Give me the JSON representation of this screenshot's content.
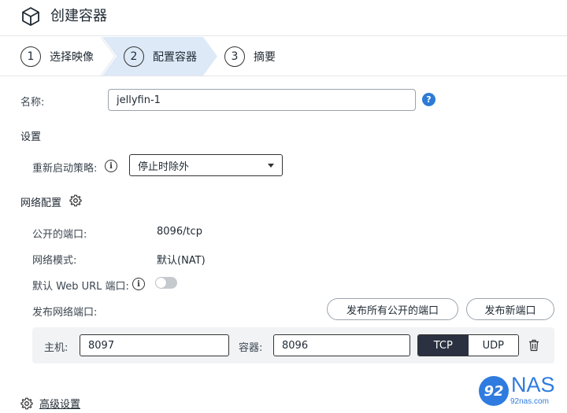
{
  "header": {
    "title": "创建容器",
    "icon": "cube-icon"
  },
  "steps": [
    {
      "num": "1",
      "label": "选择映像"
    },
    {
      "num": "2",
      "label": "配置容器"
    },
    {
      "num": "3",
      "label": "摘要"
    }
  ],
  "active_step_color": "#dde9f7",
  "name": {
    "label": "名称:",
    "value": "jellyfin-1"
  },
  "settings": {
    "section_title": "设置",
    "restart_label": "重新启动策略:",
    "restart_value": "停止时除外"
  },
  "network": {
    "section_title": "网络配置",
    "public_ports_label": "公开的端口:",
    "public_ports_value": "8096/tcp",
    "mode_label": "网络模式:",
    "mode_value": "默认(NAT)",
    "web_url_label": "默认 Web URL 端口:",
    "publish_label": "发布网络端口:",
    "publish_all_button": "发布所有公开的端口",
    "publish_new_button": "发布新端口"
  },
  "port_mapping": {
    "host_label": "主机:",
    "host_value": "8097",
    "container_label": "容器:",
    "container_value": "8096",
    "protocol_options": [
      "TCP",
      "UDP"
    ],
    "protocol_selected": "TCP"
  },
  "advanced": {
    "label": "高级设置"
  },
  "watermark": {
    "badge": "92",
    "brand": "NAS",
    "site": "92nas.com"
  },
  "colors": {
    "accent": "#2e7bd6",
    "segment_active": "#2b3140"
  }
}
